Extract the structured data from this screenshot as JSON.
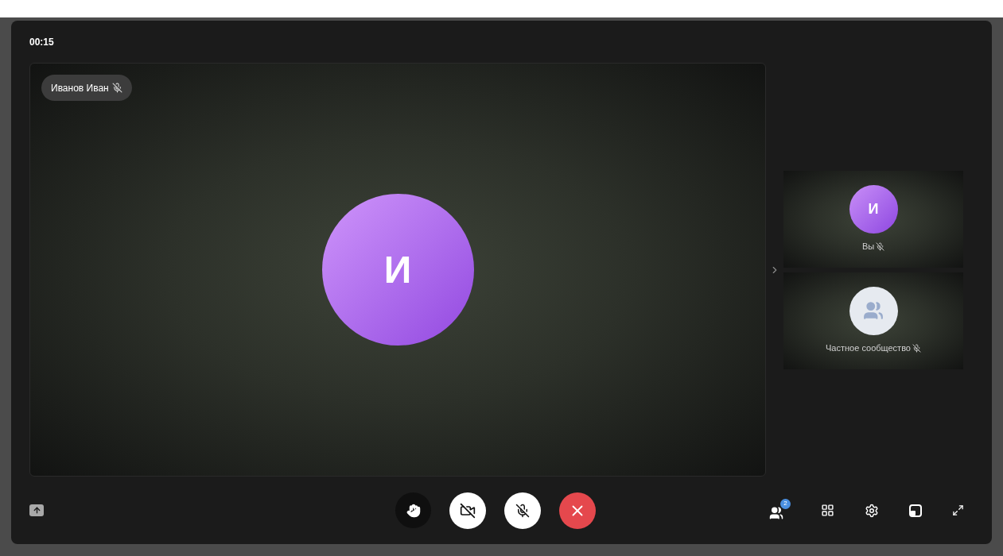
{
  "timer": "00:15",
  "main_tile": {
    "name": "Иванов Иван",
    "muted": true,
    "initial": "И"
  },
  "side_tiles": [
    {
      "kind": "avatar",
      "label": "Вы",
      "initial": "И",
      "muted": true
    },
    {
      "kind": "group",
      "label": "Частное сообщество",
      "muted": true
    }
  ],
  "controls": {
    "camera_on": false,
    "mic_on": false
  },
  "participants_count": "2"
}
